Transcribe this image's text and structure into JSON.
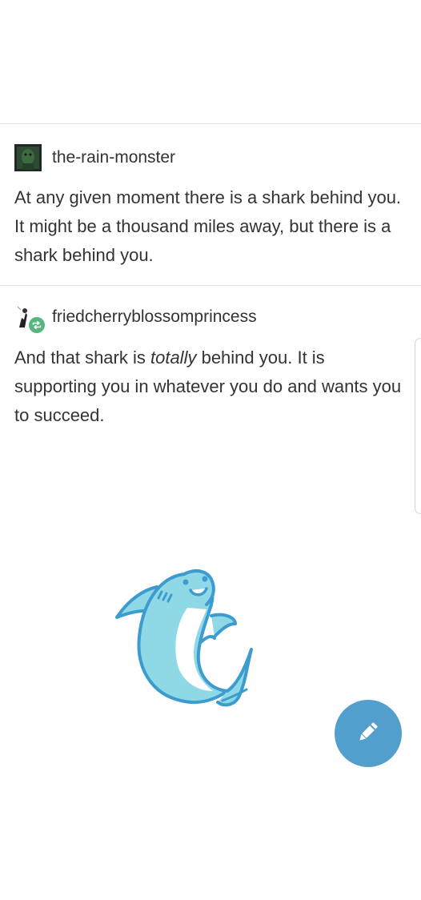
{
  "posts": [
    {
      "username": "the-rain-monster",
      "text": "At any given moment there is a shark behind you. It might be a thousand miles away, but there is a shark behind you."
    },
    {
      "username": "friedcherryblossomprincess",
      "text_before": "And that shark is ",
      "text_emphasis": "totally",
      "text_after": " behind you. It is supporting you in whatever you do and wants you to succeed."
    }
  ],
  "icons": {
    "fab": "pencil-icon",
    "reblog_badge": "reblog-icon",
    "illustration": "shark-illustration"
  },
  "colors": {
    "fab": "#529ecc",
    "reblog_badge": "#56b67e",
    "shark_body": "#8fd8e6",
    "shark_outline": "#3d9ccf"
  }
}
